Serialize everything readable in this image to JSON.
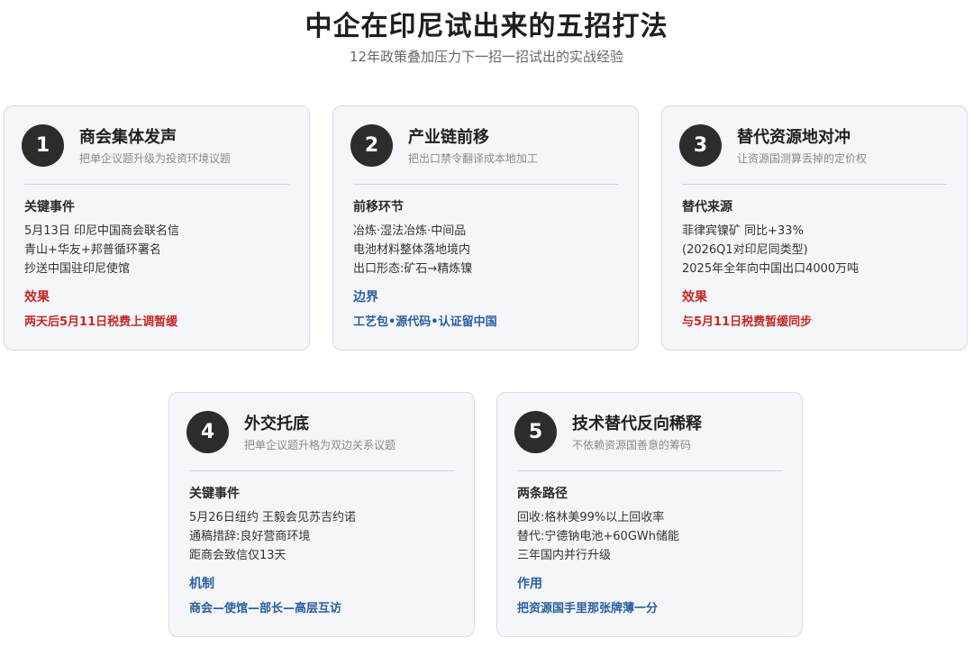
{
  "header": {
    "title": "中企在印尼试出来的五招打法",
    "subtitle": "12年政策叠加压力下一招一招试出的实战经验"
  },
  "colors": {
    "red_accent": "#c62828",
    "blue_accent": "#2a5d9f",
    "badge": "#2c2c2c",
    "card_bg": "#f4f6f9"
  },
  "cards": [
    {
      "number": "1",
      "title": "商会集体发声",
      "desc": "把单企议题升级为投资环境议题",
      "section_label": "关键事件",
      "lines": [
        "5月13日 印尼中国商会联名信",
        "青山+华友+邦普循环署名",
        "抄送中国驻印尼使馆"
      ],
      "result_label": "效果",
      "result_text": "两天后5月11日税费上调暂缓",
      "accent": "red"
    },
    {
      "number": "2",
      "title": "产业链前移",
      "desc": "把出口禁令翻译成本地加工",
      "section_label": "前移环节",
      "lines": [
        "冶炼·湿法冶炼·中间品",
        "电池材料整体落地境内",
        "出口形态:矿石→精炼镍"
      ],
      "result_label": "边界",
      "result_text": "工艺包•源代码•认证留中国",
      "accent": "blue"
    },
    {
      "number": "3",
      "title": "替代资源地对冲",
      "desc": "让资源国测算丢掉的定价权",
      "section_label": "替代来源",
      "lines": [
        "菲律宾镍矿 同比+33%",
        "(2026Q1对印尼同类型)",
        "2025年全年向中国出口4000万吨"
      ],
      "result_label": "效果",
      "result_text": "与5月11日税费暂缓同步",
      "accent": "red"
    },
    {
      "number": "4",
      "title": "外交托底",
      "desc": "把单企议题升格为双边关系议题",
      "section_label": "关键事件",
      "lines": [
        "5月26日纽约 王毅会见苏吉约诺",
        "通稿措辞:良好营商环境",
        "距商会致信仅13天"
      ],
      "result_label": "机制",
      "result_text": "商会—使馆—部长—高层互访",
      "accent": "blue"
    },
    {
      "number": "5",
      "title": "技术替代反向稀释",
      "desc": "不依赖资源国善意的筹码",
      "section_label": "两条路径",
      "lines": [
        "回收:格林美99%以上回收率",
        "替代:宁德钠电池+60GWh储能",
        "三年国内并行升级"
      ],
      "result_label": "作用",
      "result_text": "把资源国手里那张牌薄一分",
      "accent": "blue"
    }
  ]
}
